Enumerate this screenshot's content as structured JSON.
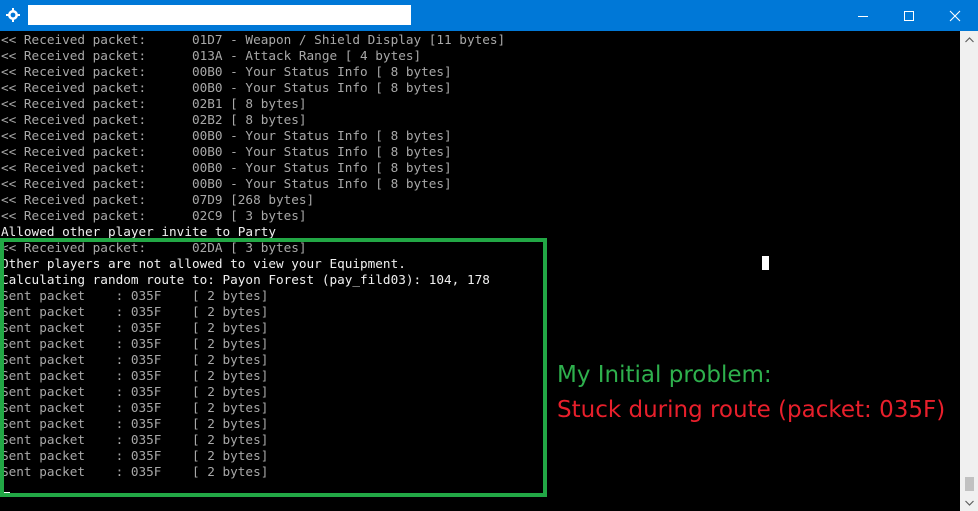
{
  "window": {
    "title": "",
    "accent_color": "#0078d7",
    "controls": {
      "minimize": "minimize-icon",
      "maximize": "maximize-icon",
      "close": "close-icon"
    }
  },
  "console": {
    "lines": [
      {
        "text": "<< Received packet:      01D7 - Weapon / Shield Display [11 bytes]",
        "style": "dim"
      },
      {
        "text": "<< Received packet:      013A - Attack Range [ 4 bytes]",
        "style": "dim"
      },
      {
        "text": "<< Received packet:      00B0 - Your Status Info [ 8 bytes]",
        "style": "dim"
      },
      {
        "text": "<< Received packet:      00B0 - Your Status Info [ 8 bytes]",
        "style": "dim"
      },
      {
        "text": "<< Received packet:      02B1 [ 8 bytes]",
        "style": "dim"
      },
      {
        "text": "<< Received packet:      02B2 [ 8 bytes]",
        "style": "dim"
      },
      {
        "text": "<< Received packet:      00B0 - Your Status Info [ 8 bytes]",
        "style": "dim"
      },
      {
        "text": "<< Received packet:      00B0 - Your Status Info [ 8 bytes]",
        "style": "dim"
      },
      {
        "text": "<< Received packet:      00B0 - Your Status Info [ 8 bytes]",
        "style": "dim"
      },
      {
        "text": "<< Received packet:      00B0 - Your Status Info [ 8 bytes]",
        "style": "dim"
      },
      {
        "text": "<< Received packet:      07D9 [268 bytes]",
        "style": "dim"
      },
      {
        "text": "<< Received packet:      02C9 [ 3 bytes]",
        "style": "dim"
      },
      {
        "text": "Allowed other player invite to Party",
        "style": "bright"
      },
      {
        "text": "<< Received packet:      02DA [ 3 bytes]",
        "style": "dim"
      },
      {
        "text": "Other players are not allowed to view your Equipment.",
        "style": "bright"
      },
      {
        "text": "Calculating random route to: Payon Forest (pay_fild03): 104, 178",
        "style": "bright"
      },
      {
        "text": "Sent packet    : 035F    [ 2 bytes]",
        "style": "dim"
      },
      {
        "text": "Sent packet    : 035F    [ 2 bytes]",
        "style": "dim"
      },
      {
        "text": "Sent packet    : 035F    [ 2 bytes]",
        "style": "dim"
      },
      {
        "text": "Sent packet    : 035F    [ 2 bytes]",
        "style": "dim"
      },
      {
        "text": "Sent packet    : 035F    [ 2 bytes]",
        "style": "dim"
      },
      {
        "text": "Sent packet    : 035F    [ 2 bytes]",
        "style": "dim"
      },
      {
        "text": "Sent packet    : 035F    [ 2 bytes]",
        "style": "dim"
      },
      {
        "text": "Sent packet    : 035F    [ 2 bytes]",
        "style": "dim"
      },
      {
        "text": "Sent packet    : 035F    [ 2 bytes]",
        "style": "dim"
      },
      {
        "text": "Sent packet    : 035F    [ 2 bytes]",
        "style": "dim"
      },
      {
        "text": "Sent packet    : 035F    [ 2 bytes]",
        "style": "dim"
      },
      {
        "text": "Sent packet    : 035F    [ 2 bytes]",
        "style": "dim"
      }
    ]
  },
  "annotation": {
    "highlight_color": "#22a745",
    "note_line_1": "My Initial problem:",
    "note_line_1_color": "#2eb04d",
    "note_line_2": "Stuck during route (packet: 035F)",
    "note_line_2_color": "#e81f2b"
  },
  "scrollbar": {
    "up": "chevron-up-icon",
    "down": "chevron-down-icon"
  }
}
